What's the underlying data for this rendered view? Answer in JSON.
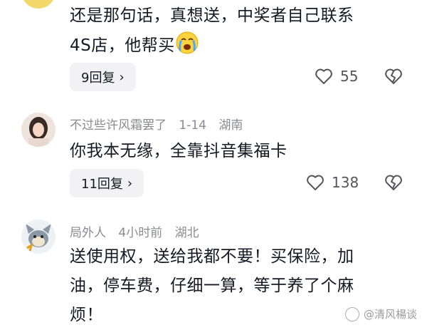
{
  "comments": [
    {
      "text_line1": "还是那句话，真想送，中奖者自己联系",
      "text_line2": "4S店，他帮买",
      "emoji": "crying-face",
      "reply_label": "9回复",
      "likes": "55"
    },
    {
      "author": "不过些许风霜罢了",
      "date": "1-14",
      "location": "湖南",
      "text": "你我本无缘，全靠抖音集福卡",
      "reply_label": "11回复",
      "likes": "138"
    },
    {
      "author": "局外人",
      "date": "4小时前",
      "location": "湖北",
      "text_line1": "送使用权，送给我都不要！买保险，加",
      "text_line2": "油，停车费，仔细一算，等于养了个麻",
      "text_line3": "烦！"
    }
  ],
  "watermark": "@清风楊谈",
  "colors": {
    "accent_text": "#161823",
    "meta": "#8a8b91",
    "button_bg": "#f2f2f4"
  }
}
